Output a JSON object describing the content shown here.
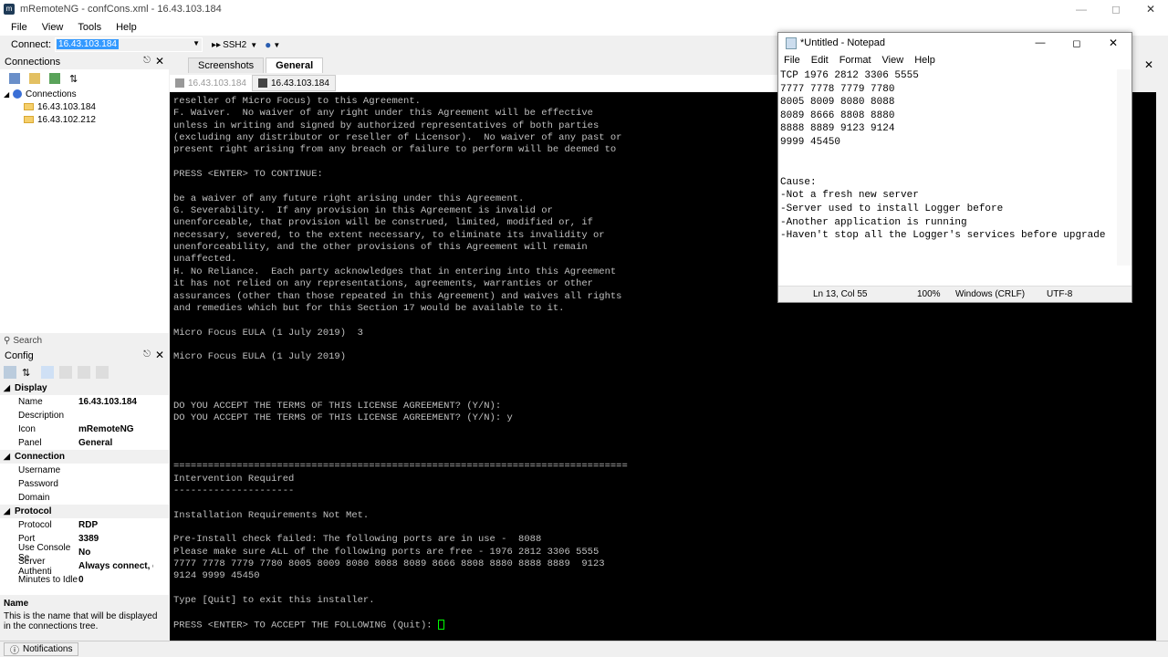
{
  "window": {
    "title": "mRemoteNG - confCons.xml - 16.43.103.184"
  },
  "menu": [
    "File",
    "View",
    "Tools",
    "Help"
  ],
  "connectbar": {
    "label": "Connect:",
    "value": "16.43.103.184",
    "protocol": "SSH2"
  },
  "connections_panel": {
    "title": "Connections",
    "root": "Connections",
    "items": [
      "16.43.103.184",
      "16.43.102.212"
    ]
  },
  "search": {
    "placeholder": "Search"
  },
  "config_panel": {
    "title": "Config",
    "categories": [
      {
        "name": "Display",
        "rows": [
          {
            "key": "Name",
            "value": "16.43.103.184"
          },
          {
            "key": "Description",
            "value": ""
          },
          {
            "key": "Icon",
            "value": "mRemoteNG"
          },
          {
            "key": "Panel",
            "value": "General"
          }
        ]
      },
      {
        "name": "Connection",
        "rows": [
          {
            "key": "Username",
            "value": ""
          },
          {
            "key": "Password",
            "value": ""
          },
          {
            "key": "Domain",
            "value": ""
          }
        ]
      },
      {
        "name": "Protocol",
        "rows": [
          {
            "key": "Protocol",
            "value": "RDP"
          },
          {
            "key": "Port",
            "value": "3389"
          },
          {
            "key": "Use Console Se",
            "value": "No"
          },
          {
            "key": "Server Authenti",
            "value": "Always connect, ev"
          },
          {
            "key": "Minutes to Idle",
            "value": "0"
          }
        ]
      }
    ]
  },
  "name_help": {
    "title": "Name",
    "text": "This is the name that will be displayed in the connections tree."
  },
  "statusbar": {
    "notifications": "Notifications"
  },
  "tabs": {
    "screenshots": "Screenshots",
    "general": "General"
  },
  "subtabs": [
    "16.43.103.184",
    "16.43.103.184"
  ],
  "terminal": {
    "lines": [
      "reseller of Micro Focus) to this Agreement.",
      "F. Waiver.  No waiver of any right under this Agreement will be effective",
      "unless in writing and signed by authorized representatives of both parties",
      "(excluding any distributor or reseller of Licensor).  No waiver of any past or",
      "present right arising from any breach or failure to perform will be deemed to",
      "",
      "PRESS <ENTER> TO CONTINUE:",
      "",
      "be a waiver of any future right arising under this Agreement.",
      "G. Severability.  If any provision in this Agreement is invalid or",
      "unenforceable, that provision will be construed, limited, modified or, if",
      "necessary, severed, to the extent necessary, to eliminate its invalidity or",
      "unenforceability, and the other provisions of this Agreement will remain",
      "unaffected.",
      "H. No Reliance.  Each party acknowledges that in entering into this Agreement",
      "it has not relied on any representations, agreements, warranties or other",
      "assurances (other than those repeated in this Agreement) and waives all rights",
      "and remedies which but for this Section 17 would be available to it.",
      "",
      "Micro Focus EULA (1 July 2019)  3",
      "",
      "Micro Focus EULA (1 July 2019)",
      "",
      "",
      "",
      "DO YOU ACCEPT THE TERMS OF THIS LICENSE AGREEMENT? (Y/N):",
      "DO YOU ACCEPT THE TERMS OF THIS LICENSE AGREEMENT? (Y/N): y",
      "",
      "",
      "",
      "===============================================================================",
      "Intervention Required",
      "---------------------",
      "",
      "Installation Requirements Not Met.",
      "",
      "Pre-Install check failed: The following ports are in use -  8088",
      "Please make sure ALL of the following ports are free - 1976 2812 3306 5555",
      "7777 7778 7779 7780 8005 8009 8080 8088 8089 8666 8808 8880 8888 8889  9123",
      "9124 9999 45450",
      "",
      "Type [Quit] to exit this installer.",
      "",
      "PRESS <ENTER> TO ACCEPT THE FOLLOWING (Quit): "
    ]
  },
  "notepad": {
    "title": "*Untitled - Notepad",
    "menu": [
      "File",
      "Edit",
      "Format",
      "View",
      "Help"
    ],
    "text": "TCP 1976 2812 3306 5555\n7777 7778 7779 7780\n8005 8009 8080 8088\n8089 8666 8808 8880\n8888 8889 9123 9124\n9999 45450\n\n\nCause:\n-Not a fresh new server\n-Server used to install Logger before\n-Another application is running\n-Haven't stop all the Logger's services before upgrade",
    "status": {
      "position": "Ln 13, Col 55",
      "zoom": "100%",
      "eol": "Windows (CRLF)",
      "encoding": "UTF-8"
    }
  }
}
